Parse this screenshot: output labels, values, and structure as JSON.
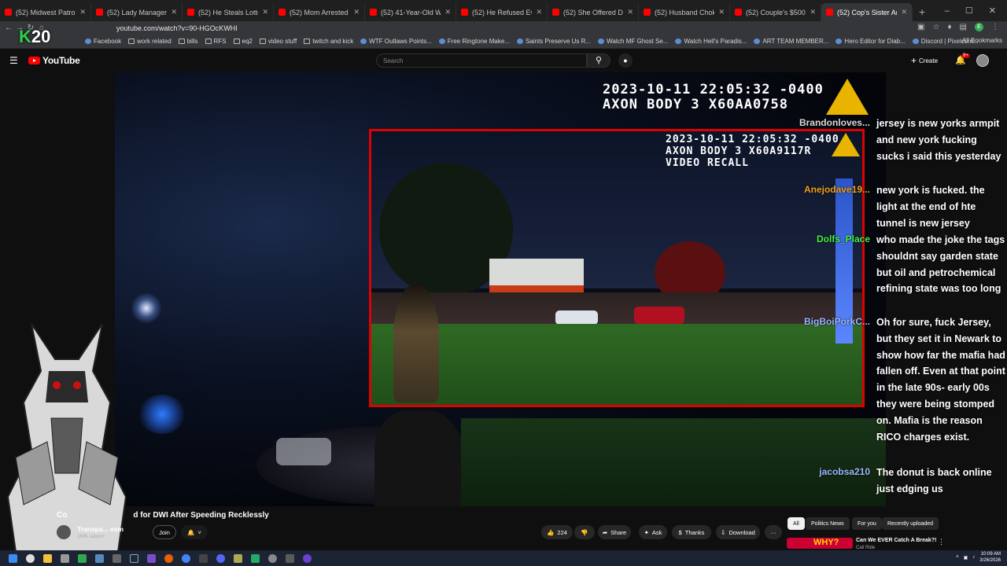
{
  "browser": {
    "tabs": [
      {
        "title": "(52) Midwest Patrol – YouTube",
        "active": false
      },
      {
        "title": "(52) Lady Manager Finds Presi",
        "active": false
      },
      {
        "title": "(52) He Steals Lottery Tickets",
        "active": false
      },
      {
        "title": "(52) Mom Arrested After Slap",
        "active": false
      },
      {
        "title": "(52) 41-Year-Old Woman SNA",
        "active": false
      },
      {
        "title": "(52) He Refused Every Officer",
        "active": false
      },
      {
        "title": "(52) She Offered Drugs to Ev",
        "active": false
      },
      {
        "title": "(52) Husband Chokes Wife Aft",
        "active": false
      },
      {
        "title": "(52) Couple's $500 Dinner Ta",
        "active": false
      },
      {
        "title": "(52) Cop's Sister Arrested",
        "active": true
      }
    ],
    "new_tab_glyph": "+",
    "url": "youtube.com/watch?v=90-HGOcKWHI",
    "profile_initial": "E",
    "bookmarks": [
      "Facebook",
      "work related",
      "bills",
      "RFS",
      "eq2",
      "video stuff",
      "twitch and kick",
      "WTF Outlaws Points...",
      "Free Ringtone Make...",
      "Saints Preserve Us R...",
      "Watch MF Ghost Se...",
      "Watch Hell's Paradis...",
      "ART TEAM MEMBER...",
      "Hero Editor for Diab...",
      "Discord | Pixelcom..."
    ],
    "all_bookmarks": "All Bookmarks"
  },
  "youtube": {
    "logo_text": "YouTube",
    "search_placeholder": "Search",
    "create_label": "Create",
    "notification_count": "9+"
  },
  "video": {
    "main_timestamp": "2023-10-11 22:05:32 -0400",
    "main_device": "AXON BODY 3 X60AA0758",
    "inset_timestamp": "2023-10-11 22:05:32 -0400",
    "inset_device": "AXON BODY 3 X60A9117R",
    "inset_label": "VIDEO RECALL"
  },
  "stream_overlay": {
    "badge_letter": "K",
    "badge_number": "20"
  },
  "chat": [
    {
      "user": "Brandonloves...",
      "color": "#d9d9d9",
      "message": "jersey is new yorks armpit and new york fucking sucks i said this yesterday"
    },
    {
      "user": "Anejodave19...",
      "color": "#f0a020",
      "message": "new york is fucked. the light at the end of hte tunnel is new jersey"
    },
    {
      "user": "Dolfs_Place",
      "color": "#44ee44",
      "message": "who made the joke the tags shouldnt say garden state but oil and petrochemical refining state was too long"
    },
    {
      "user": "BigBoiPorkC...",
      "color": "#9ab8ff",
      "message": "Oh for sure, fuck Jersey, but they set it in Newark to show how far the mafia had fallen off. Even at that point in the late 90s- early 00s they were being stomped on. Mafia is the reason RICO charges exist."
    },
    {
      "user": "jacobsa210",
      "color": "#9ab8ff",
      "message": "The donut is back online just edging us"
    }
  ],
  "watch": {
    "title": "Cop's Sister ... for DWI After Speeding Recklessly",
    "title_visible_left": "Co",
    "title_visible_right": "d for DWI After Speeding Recklessly",
    "channel": "Transpa... eam",
    "subscribers": "160K subscri",
    "join": "Join",
    "likes": "224",
    "share": "Share",
    "ask": "Ask",
    "thanks": "Thanks",
    "download": "Download",
    "more": "···"
  },
  "sidebar": {
    "chips": [
      "All",
      "Politics News",
      "For you",
      "Recently uploaded"
    ],
    "selected_chip": "All",
    "rec_title": "Can We EVER Catch A Break?!",
    "rec_thumb_text": "WHY?",
    "rec_channel": "Cali Ride"
  },
  "taskbar": {
    "time": "10:09 AM",
    "date": "3/26/2026"
  }
}
